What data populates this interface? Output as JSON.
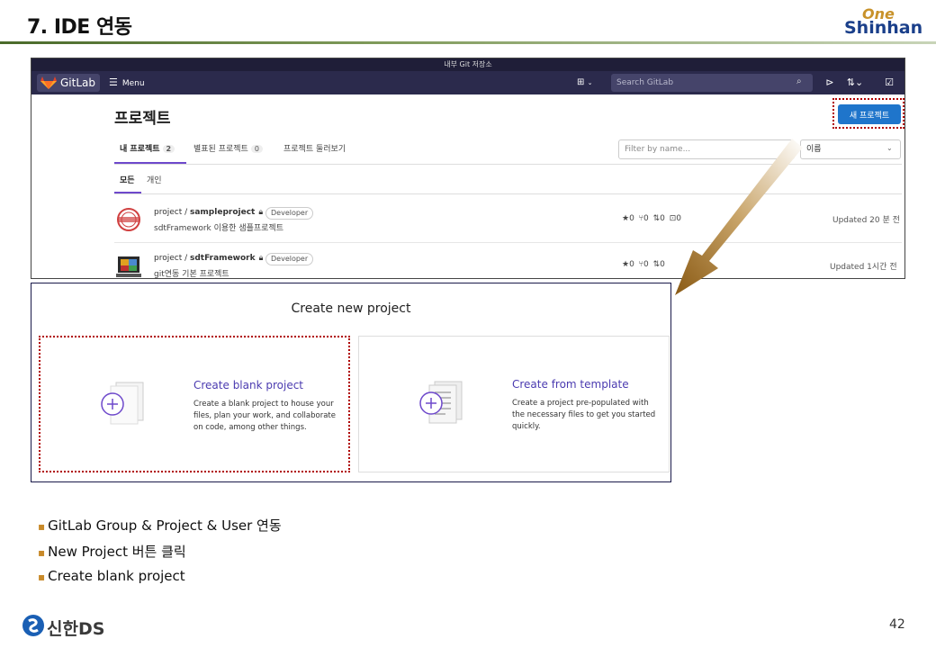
{
  "slide": {
    "title": "7. IDE 연동",
    "logo_one": "One",
    "logo_shinhan": "Shinhan",
    "page_number": "42",
    "footer_logo": "신한DS"
  },
  "gitlab": {
    "topstrip_label": "내부 Git 저장소",
    "brand": "GitLab",
    "menu_label": "Menu",
    "search_placeholder": "Search GitLab",
    "page_title": "프로젝트",
    "new_project_button": "새 프로젝트",
    "tabs": [
      {
        "label": "내 프로젝트",
        "count": "2"
      },
      {
        "label": "별표된 프로젝트",
        "count": "0"
      },
      {
        "label": "프로젝트 둘러보기",
        "count": ""
      }
    ],
    "filter_placeholder": "Filter by name...",
    "sort_label": "이름",
    "subtabs": [
      "모든",
      "개인"
    ],
    "projects": [
      {
        "namespace": "project / ",
        "name": "sampleproject",
        "role": "Developer",
        "description": "sdtFramework 이용한 샘플프로젝트",
        "stats": "★0  ⑂0  ⇅0  ⊡0",
        "updated": "Updated 20 분 전"
      },
      {
        "namespace": "project / ",
        "name": "sdtFramework",
        "role": "Developer",
        "description": "git연동 기본 프로젝트",
        "stats": "★0  ⑂0  ⇅0",
        "updated": "Updated 1시간 전"
      }
    ]
  },
  "create_project": {
    "title": "Create new project",
    "cards": [
      {
        "title": "Create blank project",
        "description": "Create a blank project to house your files, plan your work, and collaborate on code, among other things."
      },
      {
        "title": "Create from template",
        "description": "Create a project pre-populated with the necessary files to get you started quickly."
      }
    ]
  },
  "bullets": [
    "GitLab  Group & Project & User 연동",
    "New Project 버튼 클릭",
    "Create blank project"
  ],
  "colors": {
    "gitlab_nav": "#2b2a4c",
    "accent_blue": "#1f75cb",
    "link_purple": "#4b3bb0",
    "highlight_red": "#b00000",
    "arrow_brown": "#8a5a14"
  }
}
